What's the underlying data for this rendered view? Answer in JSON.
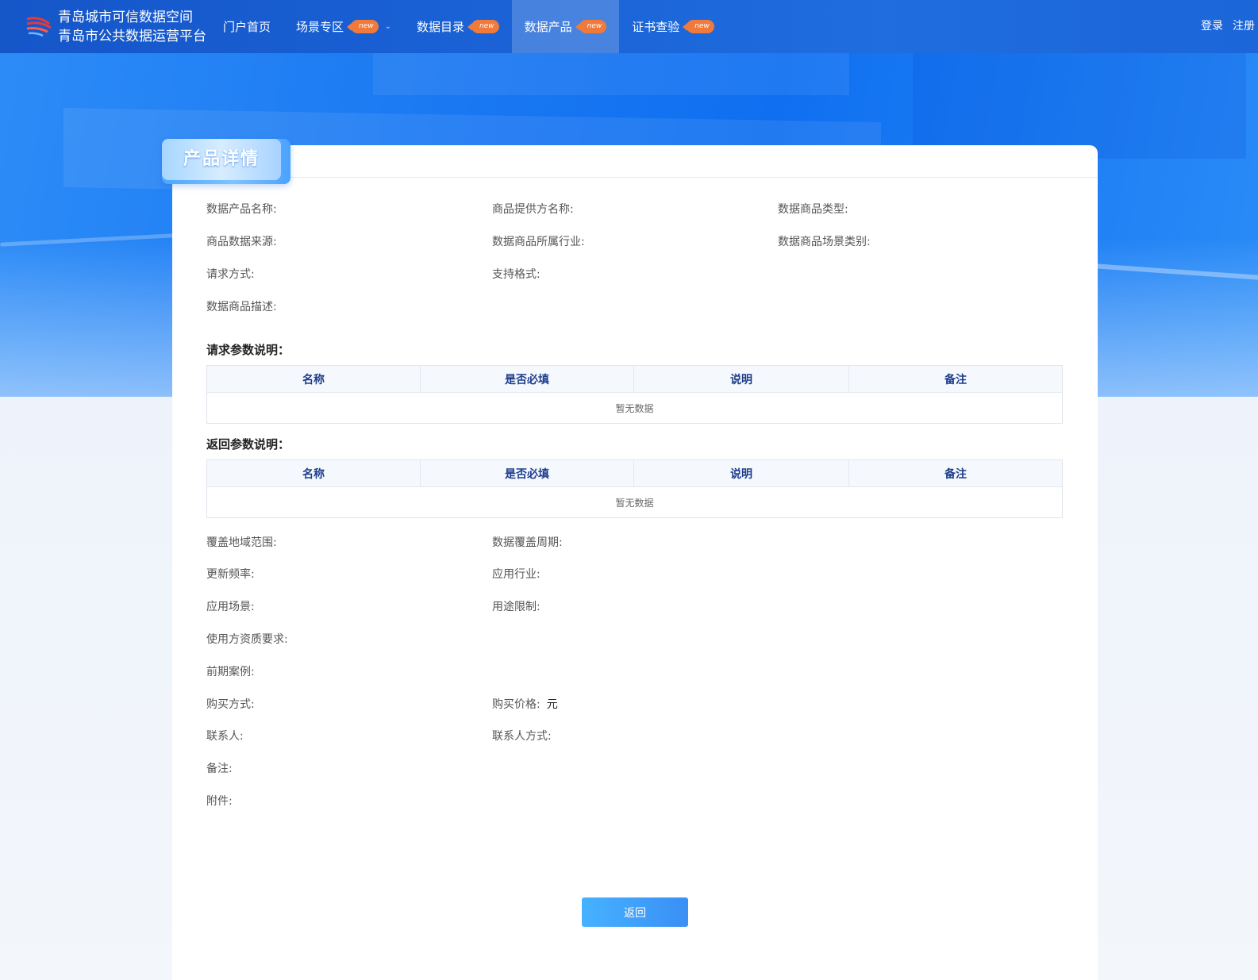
{
  "header": {
    "brand_line1": "青岛城市可信数据空间",
    "brand_line2": "青岛市公共数据运营平台",
    "nav": [
      {
        "label": "门户首页",
        "badge": ""
      },
      {
        "label": "场景专区",
        "badge": "new"
      },
      {
        "label": "数据目录",
        "badge": "new"
      },
      {
        "label": "数据产品",
        "badge": "new"
      },
      {
        "label": "证书查验",
        "badge": "new"
      }
    ],
    "active_nav": "数据产品",
    "login": "登录",
    "register": "注册"
  },
  "page": {
    "tab_title": "产品详情"
  },
  "fields": {
    "product_name": "数据产品名称:",
    "provider_name": "商品提供方名称:",
    "goods_type": "数据商品类型:",
    "data_source": "商品数据来源:",
    "industry": "数据商品所属行业:",
    "scene_category": "数据商品场景类别:",
    "request_method": "请求方式:",
    "supported_format": "支持格式:",
    "description": "数据商品描述:",
    "coverage_region": "覆盖地域范围:",
    "coverage_period": "数据覆盖周期:",
    "update_frequency": "更新频率:",
    "applied_industry": "应用行业:",
    "applied_scene": "应用场景:",
    "usage_limit": "用途限制:",
    "user_qualification": "使用方资质要求:",
    "previous_cases": "前期案例:",
    "purchase_method": "购买方式:",
    "purchase_price": "购买价格:",
    "price_unit": "元",
    "contact": "联系人:",
    "contact_method": "联系人方式:",
    "remark": "备注:",
    "attachment": "附件:"
  },
  "request_params": {
    "title": "请求参数说明：",
    "columns": [
      "名称",
      "是否必填",
      "说明",
      "备注"
    ],
    "empty_text": "暂无数据"
  },
  "response_params": {
    "title": "返回参数说明：",
    "columns": [
      "名称",
      "是否必填",
      "说明",
      "备注"
    ],
    "empty_text": "暂无数据"
  },
  "actions": {
    "back": "返回"
  }
}
